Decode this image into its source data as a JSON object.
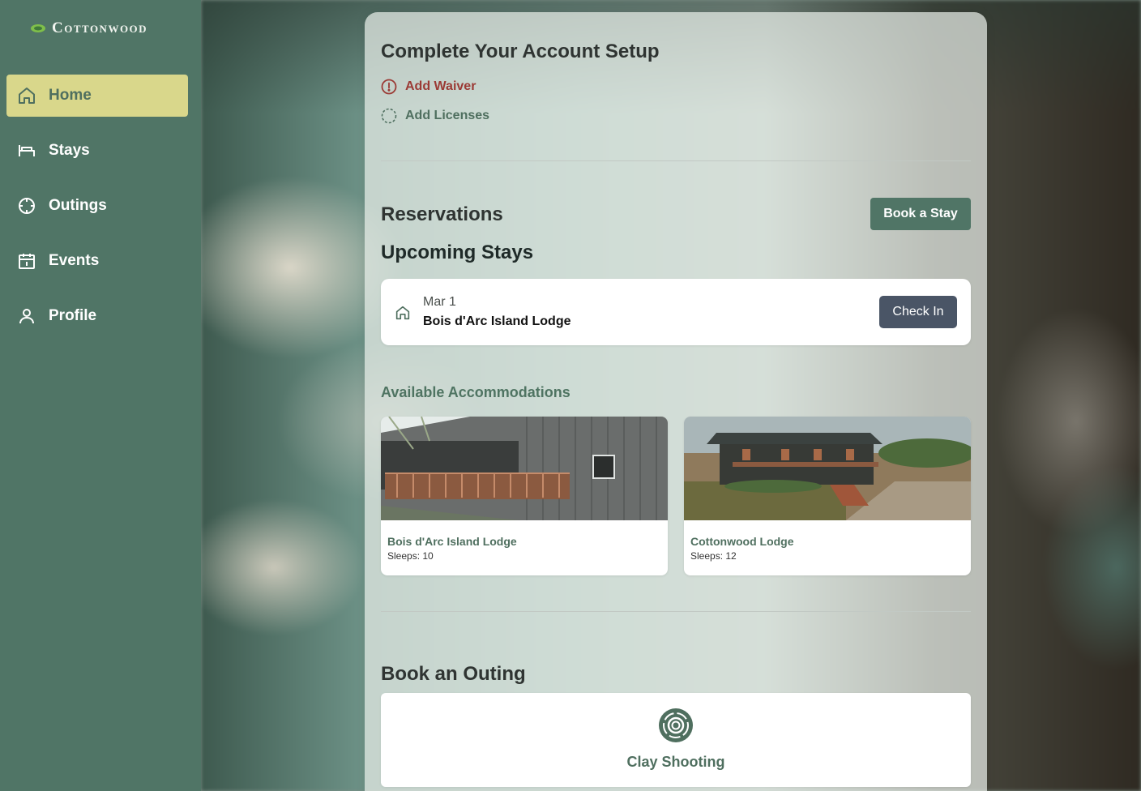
{
  "app": {
    "brand": "Cottonwood"
  },
  "sidebar": {
    "items": [
      {
        "label": "Home",
        "icon": "home-icon",
        "active": true
      },
      {
        "label": "Stays",
        "icon": "bed-icon",
        "active": false
      },
      {
        "label": "Outings",
        "icon": "crosshair-icon",
        "active": false
      },
      {
        "label": "Events",
        "icon": "calendar-icon",
        "active": false
      },
      {
        "label": "Profile",
        "icon": "user-icon",
        "active": false
      }
    ]
  },
  "setup": {
    "title": "Complete Your Account Setup",
    "items": [
      {
        "label": "Add Waiver",
        "icon": "alert-circle-icon",
        "status": "required"
      },
      {
        "label": "Add Licenses",
        "icon": "dashed-circle-icon",
        "status": "pending"
      }
    ]
  },
  "reservations": {
    "title": "Reservations",
    "book_button": "Book a Stay",
    "upcoming_title": "Upcoming Stays",
    "upcoming": [
      {
        "date": "Mar 1",
        "name": "Bois d'Arc Island Lodge",
        "action": "Check In"
      }
    ]
  },
  "accommodations": {
    "title": "Available Accommodations",
    "items": [
      {
        "name": "Bois d'Arc Island Lodge",
        "sleeps": "Sleeps: 10"
      },
      {
        "name": "Cottonwood Lodge",
        "sleeps": "Sleeps: 12"
      }
    ]
  },
  "outings": {
    "title": "Book an Outing",
    "items": [
      {
        "label": "Clay Shooting",
        "icon": "target-icon"
      }
    ]
  },
  "colors": {
    "sidebar": "#507566",
    "active_nav": "#d9d78b",
    "primary": "#507566",
    "alert": "#9b3a35",
    "checkin_button": "#4a5566"
  }
}
